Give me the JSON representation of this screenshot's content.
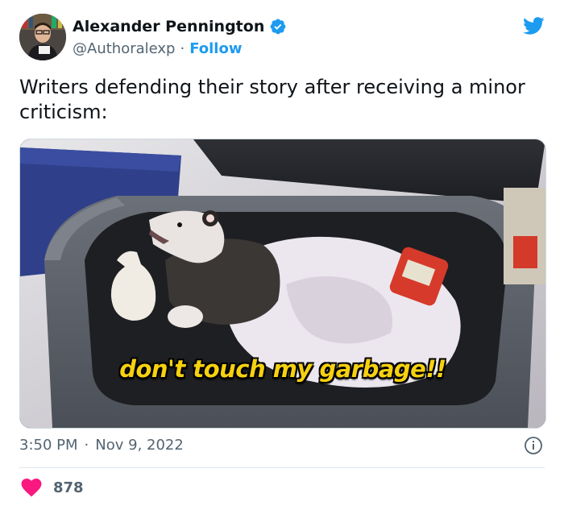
{
  "author": {
    "name": "Alexander Pennington",
    "handle": "@Authoralexp",
    "separator": "·",
    "follow_label": "Follow"
  },
  "tweet": {
    "text": "Writers defending their story after receiving a minor criticism:",
    "media_caption": "don't touch my garbage!!"
  },
  "meta": {
    "time": "3:50 PM",
    "separator": "·",
    "date": "Nov 9, 2022"
  },
  "engagement": {
    "likes": "878"
  },
  "colors": {
    "accent": "#1d9bf0",
    "heart": "#f91880",
    "caption": "#f6d10f"
  },
  "icons": [
    "verified-badge-icon",
    "twitter-bird-icon",
    "info-icon",
    "heart-icon"
  ]
}
